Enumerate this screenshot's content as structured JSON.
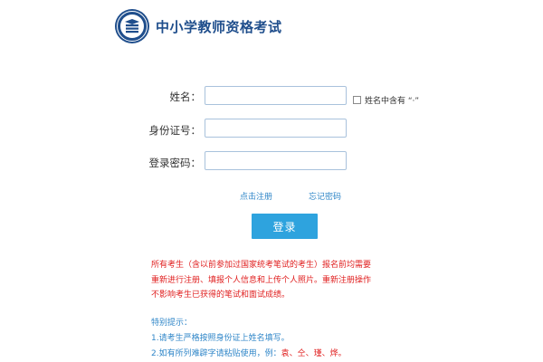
{
  "header": {
    "title": "中小学教师资格考试"
  },
  "form": {
    "name_label": "姓名：",
    "name_value": "",
    "name_dot_checkbox_label": "姓名中含有 “·”",
    "id_label": "身份证号：",
    "id_value": "",
    "password_label": "登录密码：",
    "password_value": ""
  },
  "links": {
    "register": "点击注册",
    "forgot_password": "忘记密码"
  },
  "login_button": "登录",
  "notice": {
    "lines": [
      "所有考生（含以前参加过国家统考笔试的考生）报名前均需要",
      "重新进行注册、填报个人信息和上传个人照片。重新注册操作",
      "不影响考生已获得的笔试和面试成绩。"
    ]
  },
  "tips": {
    "heading": "特别提示：",
    "item1": "1.请考生严格按照身份证上姓名填写。",
    "item2_prefix": "2.如有所列难辟字请粘贴使用，例：",
    "item2_examples": "袁、仝、瑾、烨。"
  },
  "colors": {
    "brand": "#1f4e8c",
    "accent": "#2ea3de",
    "link": "#2f86c8",
    "warning": "#e02020",
    "input_border": "#a9c2dc"
  },
  "icons": {
    "logo": "teacher-exam-emblem-icon"
  }
}
